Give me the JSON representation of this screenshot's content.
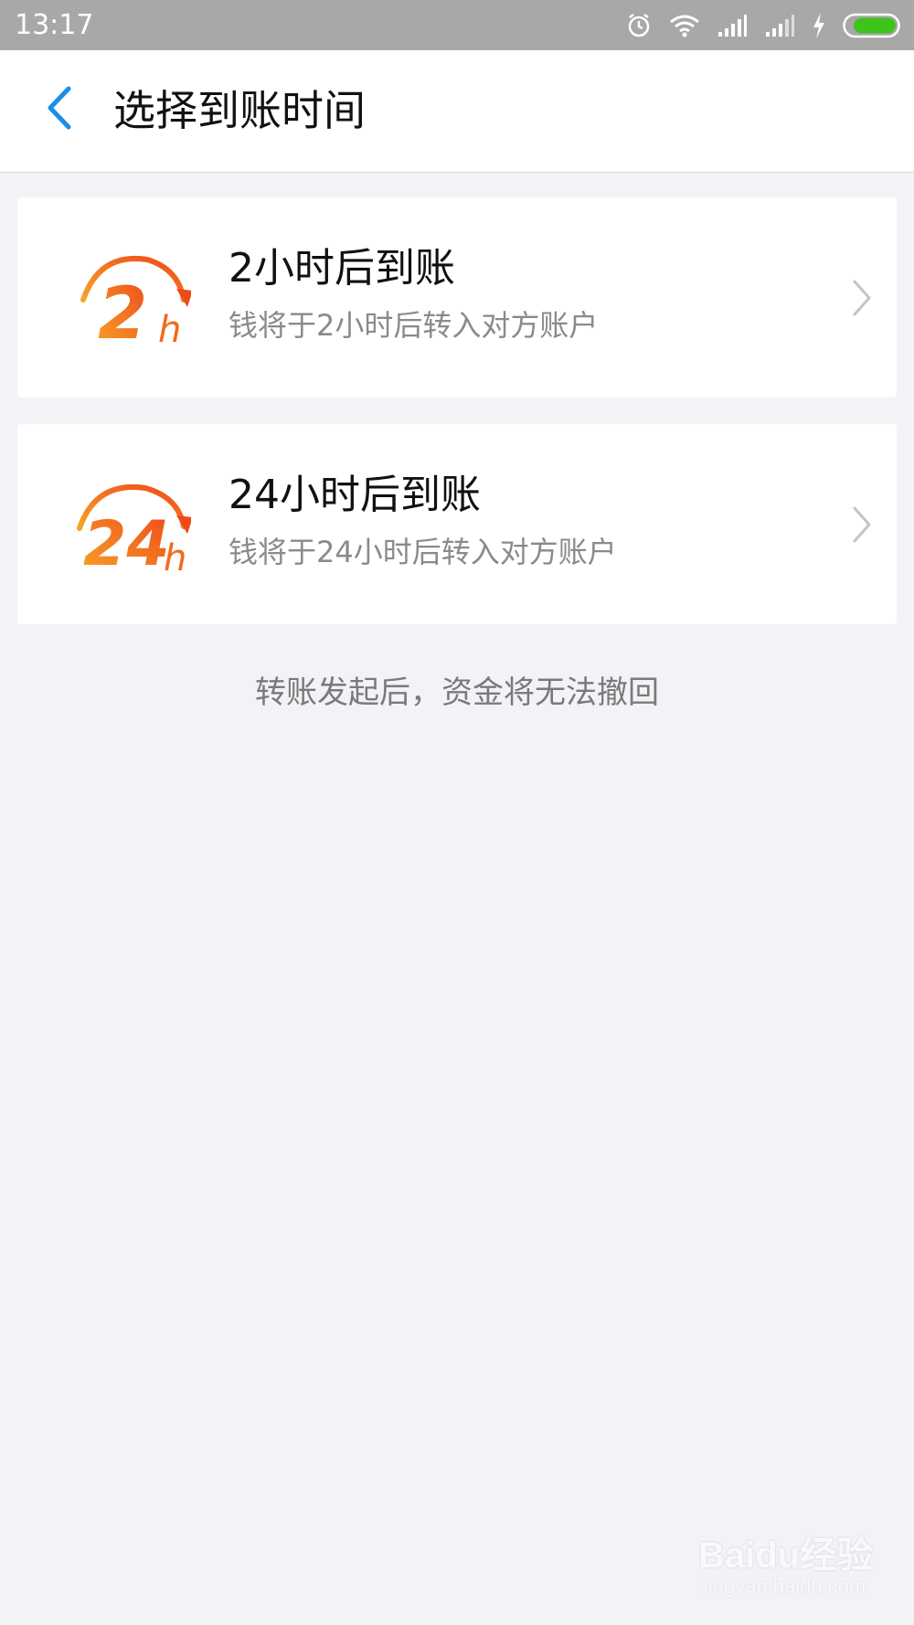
{
  "status_bar": {
    "time": "13:17",
    "icons": [
      "alarm-icon",
      "wifi-icon",
      "signal-icon",
      "signal-icon",
      "charging-icon",
      "battery-icon"
    ]
  },
  "nav": {
    "back_icon": "chevron-left-icon",
    "title": "选择到账时间"
  },
  "options": [
    {
      "icon": "2h-badge-icon",
      "icon_number": "2",
      "icon_unit": "h",
      "title": "2小时后到账",
      "description": "钱将于2小时后转入对方账户"
    },
    {
      "icon": "24h-badge-icon",
      "icon_number": "24",
      "icon_unit": "h",
      "title": "24小时后到账",
      "description": "钱将于24小时后转入对方账户"
    }
  ],
  "footer_note": "转账发起后，资金将无法撤回",
  "watermark": {
    "brand": "Baidu经验",
    "url": "jingyan.baidu.com"
  },
  "colors": {
    "accent_blue": "#1a8fe8",
    "badge_orange": "#f26a1b",
    "badge_yellow": "#f7a428",
    "background": "#f2f2f7",
    "battery_green": "#3ec41a"
  }
}
